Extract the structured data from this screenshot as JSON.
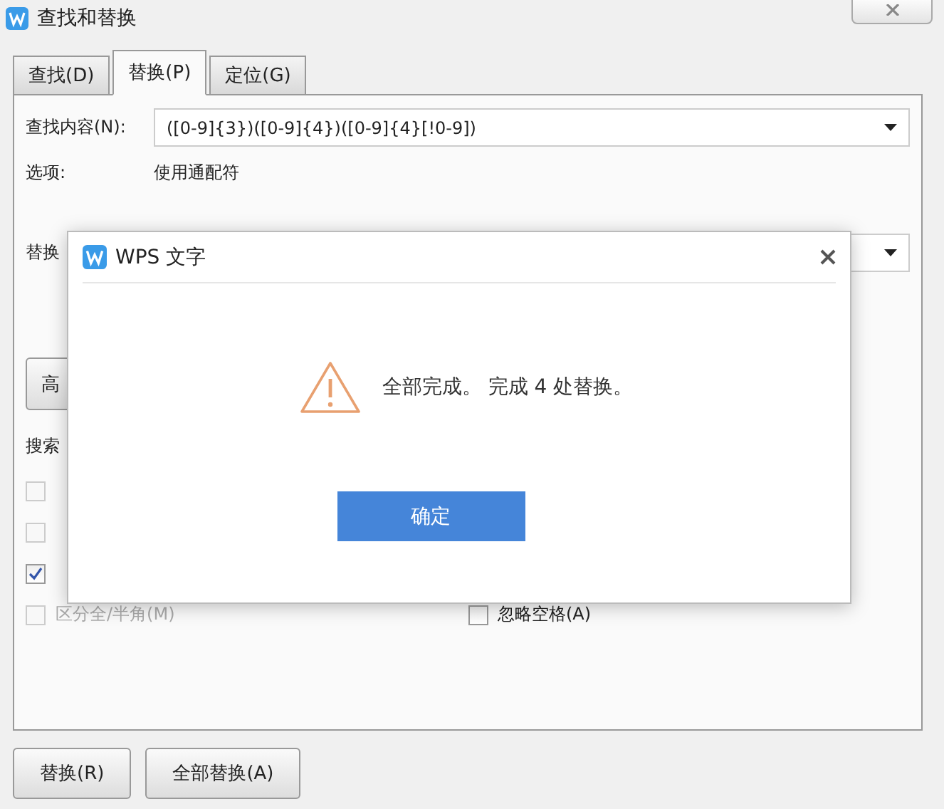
{
  "window": {
    "title": "查找和替换"
  },
  "tabs": [
    {
      "label": "查找(D)",
      "selected": false
    },
    {
      "label": "替换(P)",
      "selected": true
    },
    {
      "label": "定位(G)",
      "selected": false
    }
  ],
  "find": {
    "label": "查找内容(N):",
    "value": "([0-9]{3})([0-9]{4})([0-9]{4}[!0-9])"
  },
  "options": {
    "label": "选项:",
    "value": "使用通配符"
  },
  "replace": {
    "label": "替换"
  },
  "more_button": "高",
  "search_label": "搜索",
  "checkboxes": [
    {
      "checked": false,
      "disabled": true
    },
    {
      "checked": false,
      "disabled": true
    },
    {
      "checked": true,
      "disabled": false
    },
    {
      "label": "区分全/半角(M)",
      "checked": false,
      "disabled": true
    },
    {
      "label": "忽略空格(A)",
      "checked": false,
      "disabled": false
    }
  ],
  "buttons": [
    "替换(R)",
    "全部替换(A)"
  ],
  "message_box": {
    "title": "WPS 文字",
    "message": "全部完成。 完成 4 处替换。",
    "ok": "确定"
  }
}
